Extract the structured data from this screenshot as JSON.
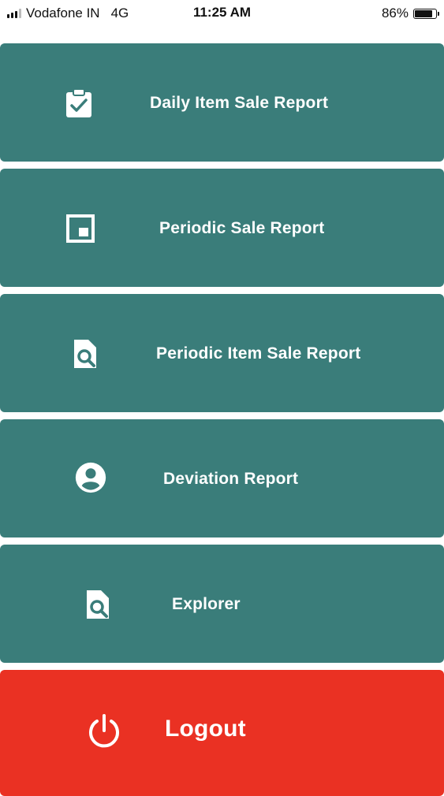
{
  "status_bar": {
    "carrier": "Vodafone IN",
    "network": "4G",
    "time": "11:25 AM",
    "battery_percent": "86%",
    "battery_level": 0.86,
    "signal_bars": 3
  },
  "menu": {
    "items": [
      {
        "label": "Daily Item Sale Report",
        "icon": "clipboard-check-icon"
      },
      {
        "label": "Periodic Sale Report",
        "icon": "square-frame-icon"
      },
      {
        "label": "Periodic Item Sale Report",
        "icon": "file-search-icon"
      },
      {
        "label": "Deviation Report",
        "icon": "account-circle-icon"
      },
      {
        "label": "Explorer",
        "icon": "file-search-icon"
      }
    ],
    "logout_label": "Logout"
  },
  "colors": {
    "tile": "#3a7d7a",
    "logout": "#ea3123",
    "text": "#ffffff"
  }
}
